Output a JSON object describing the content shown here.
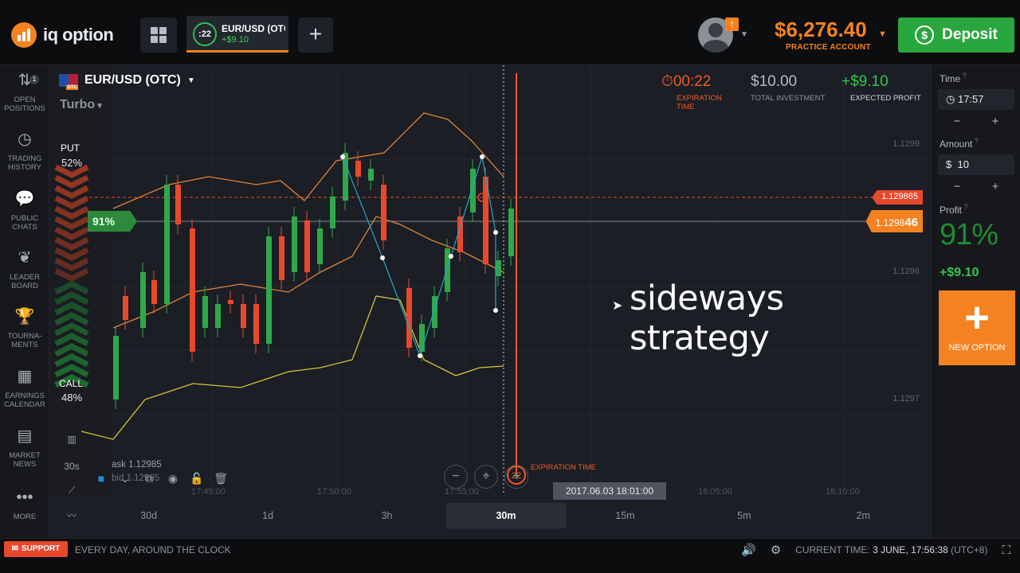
{
  "header": {
    "logo_text": "iq option",
    "asset_tab": {
      "timer": ":22",
      "name": "EUR/USD (OTC)",
      "profit": "+$9.10"
    },
    "new_tab_label": "+",
    "avatar_badge": "↑",
    "balance": "$6,276.40",
    "account_type": "PRACTICE ACCOUNT",
    "deposit_label": "Deposit"
  },
  "sidebar": {
    "items": [
      {
        "label": "OPEN POSITIONS",
        "icon": "arrows-updown-icon",
        "badge": "1"
      },
      {
        "label": "TRADING HISTORY",
        "icon": "history-clock-icon"
      },
      {
        "label": "PUBLIC CHATS",
        "icon": "chat-bubbles-icon"
      },
      {
        "label": "LEADER BOARD",
        "icon": "laurel-icon"
      },
      {
        "label": "TOURNA-MENTS",
        "icon": "trophy-icon"
      },
      {
        "label": "EARNINGS CALENDAR",
        "icon": "calendar-icon"
      },
      {
        "label": "MARKET NEWS",
        "icon": "newspaper-icon"
      },
      {
        "label": "MORE",
        "icon": "dots-icon"
      }
    ]
  },
  "chart": {
    "pair": "EUR/USD (OTC)",
    "flag_badge": "OTC",
    "mode": "Turbo",
    "put_label": "PUT",
    "put_pct": "52%",
    "call_label": "CALL",
    "call_pct": "48%",
    "payout_tag": "91%",
    "expiration_timer": "00:22",
    "expiration_caption": "EXPIRATION TIME",
    "total_investment": "$10.00",
    "total_investment_caption": "TOTAL INVESTMENT",
    "expected_profit": "+$9.10",
    "expected_profit_caption": "EXPECTED PROFIT",
    "strike_price": "1.129865",
    "current_price_main": "1.1298",
    "current_price_tail": "46",
    "y_ticks": [
      "1.1299",
      "1.1298",
      "1.1297"
    ],
    "x_ticks": [
      "17:45:00",
      "17:50:00",
      "17:55:00",
      "18:05:00",
      "18:10:00"
    ],
    "expiration_date": "2017.06.03 18:01:00",
    "expiration_line_label": "EXPIRATION TIME",
    "expiration_badge": "22",
    "ask": "ask 1.12985",
    "bid": "bid 1.12985",
    "left_timeframe": "30s",
    "caption_overlay": "sideways strategy",
    "colors": {
      "up": "#2fa84a",
      "down": "#e8482c",
      "bollinger": "#e0823a",
      "ma": "#d8c23a",
      "accent": "#f58220"
    }
  },
  "timeframes": [
    {
      "label": "30d",
      "active": false
    },
    {
      "label": "1d",
      "active": false
    },
    {
      "label": "3h",
      "active": false
    },
    {
      "label": "30m",
      "active": true
    },
    {
      "label": "15m",
      "active": false
    },
    {
      "label": "5m",
      "active": false
    },
    {
      "label": "2m",
      "active": false
    }
  ],
  "right_panel": {
    "time_label": "Time",
    "time_value": "17:57",
    "amount_label": "Amount",
    "amount_currency": "$",
    "amount_value": "10",
    "profit_label": "Profit",
    "profit_pct": "91%",
    "profit_amount": "+$9.10",
    "new_option_label": "NEW OPTION"
  },
  "footer": {
    "support_label": "SUPPORT",
    "message": "EVERY DAY, AROUND THE CLOCK",
    "current_time_label": "CURRENT TIME:",
    "current_time_value": "3 JUNE, 17:56:38",
    "timezone": "(UTC+8)"
  }
}
